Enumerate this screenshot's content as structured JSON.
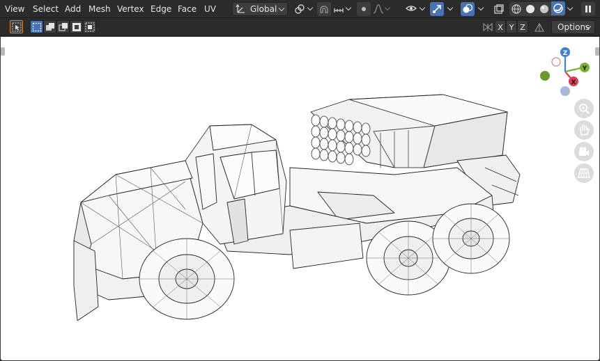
{
  "menu": [
    {
      "label": "View"
    },
    {
      "label": "Select"
    },
    {
      "label": "Add"
    },
    {
      "label": "Mesh"
    },
    {
      "label": "Vertex"
    },
    {
      "label": "Edge"
    },
    {
      "label": "Face"
    },
    {
      "label": "UV"
    }
  ],
  "header": {
    "orientation_label": "Global"
  },
  "toolbar": {
    "axis_x": "X",
    "axis_y": "Y",
    "axis_z": "Z",
    "options_label": "Options"
  },
  "gizmo": {
    "x_label": "X",
    "y_label": "Y",
    "z_label": "Z"
  },
  "colors": {
    "accent": "#4772b3",
    "axis_x": "#e03b50",
    "axis_y": "#7fb131",
    "axis_z": "#3f83cf"
  }
}
